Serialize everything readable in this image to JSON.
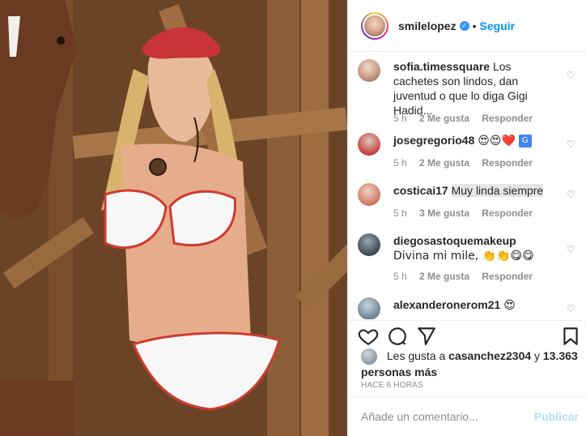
{
  "post": {
    "media_alt": "",
    "author": {
      "username": "smilelopez",
      "verified": true,
      "follow_label": "Seguir",
      "separator": "•"
    },
    "comments": [
      {
        "username": "sofia.timessquare",
        "text": "Los cachetes son lindos, dan juventud o que lo diga Gigi Hadid...",
        "time": "5 h",
        "likes": "2 Me gusta",
        "reply": "Responder"
      },
      {
        "username": "josegregorio48",
        "text": "😍😍❤️",
        "time": "5 h",
        "likes": "2 Me gusta",
        "reply": "Responder",
        "badge": "G"
      },
      {
        "username": "costicai17",
        "text": "Muy linda siempre",
        "time": "5 h",
        "likes": "3 Me gusta",
        "reply": "Responder"
      },
      {
        "username": "diegosastoquemakeup",
        "text": "Divina mi mile, 👏👏😋😋",
        "time": "5 h",
        "likes": "2 Me gusta",
        "reply": "Responder"
      },
      {
        "username": "alexanderonerom21",
        "text": "😍",
        "time": "",
        "likes": "",
        "reply": ""
      }
    ],
    "likes_text_prefix": "Les gusta a",
    "likes_user": "casanchez2304",
    "likes_text_mid": "y",
    "likes_count": "13.363 personas más",
    "timestamp": "HACE 6 HORAS",
    "comment_placeholder": "Añade un comentario...",
    "publish_label": "Publicar"
  },
  "colors": {
    "accent": "#0095f6",
    "publish_disabled": "#b2dffc",
    "muted": "#8e8e8e"
  },
  "icons": [
    "heart-icon",
    "comment-icon",
    "share-icon",
    "bookmark-icon",
    "verified-icon",
    "translate-icon"
  ]
}
